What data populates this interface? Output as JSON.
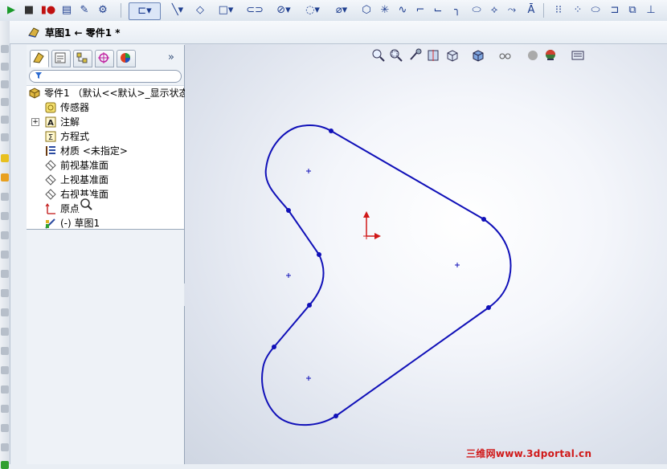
{
  "window": {
    "title": "草图1 ← 零件1 *"
  },
  "feature_tree": {
    "root_label": "零件1 （默认<<默认>_显示状态",
    "items": [
      {
        "label": "传感器",
        "icon": "sensor-icon",
        "expandable": false
      },
      {
        "label": "注解",
        "icon": "annotation-icon",
        "expandable": true
      },
      {
        "label": "方程式",
        "icon": "equation-icon",
        "expandable": false
      },
      {
        "label": "材质 <未指定>",
        "icon": "material-icon",
        "expandable": false
      },
      {
        "label": "前视基准面",
        "icon": "plane-icon",
        "expandable": false
      },
      {
        "label": "上视基准面",
        "icon": "plane-icon",
        "expandable": false
      },
      {
        "label": "右视基准面",
        "icon": "plane-icon",
        "expandable": false
      },
      {
        "label": "原点",
        "icon": "origin-icon",
        "expandable": false
      },
      {
        "label": "(-) 草图1",
        "icon": "sketch-icon",
        "expandable": false
      }
    ],
    "more_tabs_label": "»"
  },
  "toolbar": {
    "tools": [
      "rebuild-icon",
      "stop-icon",
      "record-icon",
      "new-icon",
      "edit-icon",
      "options-icon",
      "sketch-icon",
      "line-icon",
      "rectangle-icon",
      "slot-icon",
      "circle-icon",
      "arc-icon",
      "spline-icon",
      "polygon-icon",
      "point-icon",
      "ellipse-icon",
      "trim-icon",
      "extend-icon",
      "offset-icon",
      "mirror-icon",
      "pattern-icon",
      "move-icon"
    ]
  },
  "view_tools": [
    "zoom-fit-icon",
    "zoom-area-icon",
    "previous-view-icon",
    "section-view-icon",
    "view-orientation-icon",
    "display-style-icon",
    "hide-show-icon",
    "edit-appearance-icon",
    "apply-scene-icon",
    "view-settings-icon"
  ],
  "watermark": {
    "text": "三维网www.3dportal.cn"
  },
  "colors": {
    "sketch_line": "#1010b8",
    "origin_red": "#d01818",
    "watermark": "#d01818"
  }
}
